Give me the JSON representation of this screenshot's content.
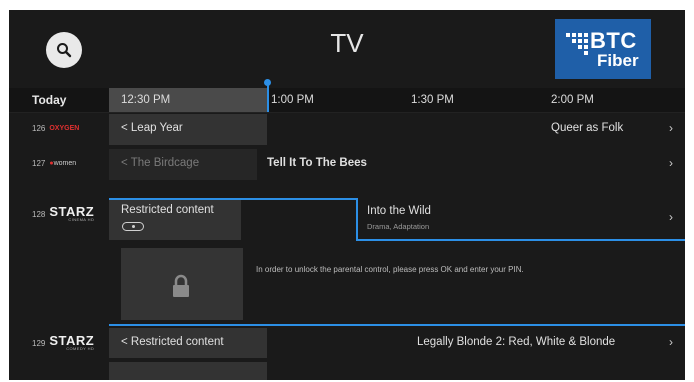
{
  "header": {
    "title": "TV",
    "logo": {
      "line1": "BTC",
      "line2": "Fiber"
    }
  },
  "timeline": {
    "day": "Today",
    "slots": [
      "12:30 PM",
      "1:00 PM",
      "1:30 PM",
      "2:00 PM"
    ]
  },
  "channels": [
    {
      "number": "126",
      "logo_text": "OXYGEN",
      "programs": [
        "< Leap Year",
        "Queer as Folk"
      ]
    },
    {
      "number": "127",
      "logo_text": "women",
      "programs": [
        "< The Birdcage",
        "Tell It To The Bees"
      ]
    },
    {
      "number": "128",
      "logo_text": "STARZ",
      "logo_sub": "CINEMA HD",
      "programs": [
        "Restricted content",
        "Into the Wild"
      ],
      "program_sub": "Drama, Adaptation"
    },
    {
      "number": "129",
      "logo_text": "STARZ",
      "logo_sub": "COMEDY HD",
      "programs": [
        "< Restricted content",
        "Legally Blonde 2: Red, White & Blonde"
      ]
    }
  ],
  "parental": {
    "message": "In order to unlock the parental control, please press OK and enter your PIN."
  },
  "icons": {
    "search": "search-icon",
    "lock": "lock-icon",
    "chevron": "chevron-right-icon"
  },
  "colors": {
    "accent": "#2c8fe6",
    "logo_bg": "#1f5fa8",
    "background": "#1a1a1a"
  }
}
